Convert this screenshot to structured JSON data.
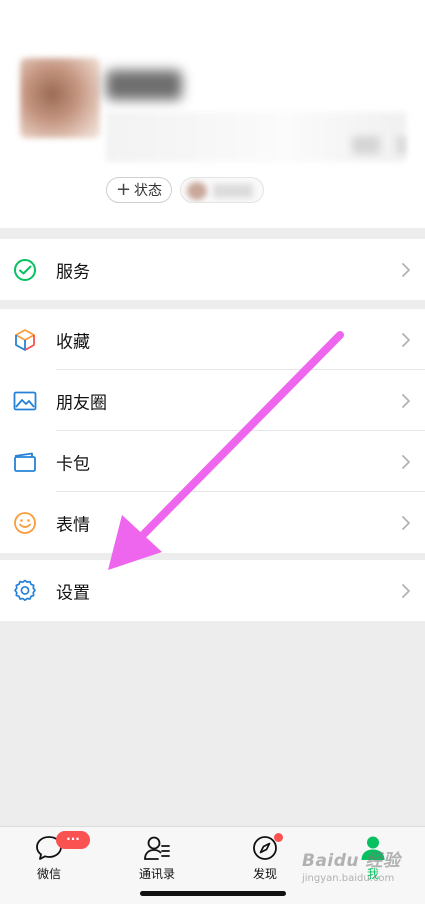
{
  "profile": {
    "status_plus": "+",
    "status_label": "状态"
  },
  "groups": [
    {
      "items": [
        {
          "label": "服务",
          "icon": "wechat-pay-icon"
        }
      ]
    },
    {
      "items": [
        {
          "label": "收藏",
          "icon": "favorites-cube-icon"
        },
        {
          "label": "朋友圈",
          "icon": "moments-image-icon"
        },
        {
          "label": "卡包",
          "icon": "card-wallet-icon"
        },
        {
          "label": "表情",
          "icon": "emoji-smiley-icon"
        }
      ]
    },
    {
      "items": [
        {
          "label": "设置",
          "icon": "gear-icon"
        }
      ]
    }
  ],
  "tabbar": {
    "tabs": [
      {
        "label": "微信",
        "badge": "···",
        "icon": "chat-bubble-icon"
      },
      {
        "label": "通讯录",
        "icon": "contacts-icon"
      },
      {
        "label": "发现",
        "icon": "compass-icon"
      },
      {
        "label": "我",
        "icon": "person-icon",
        "active": true
      }
    ]
  },
  "watermark": {
    "main": "Baidu 经验",
    "sub": "jingyan.baidu.com"
  },
  "colors": {
    "accent_green": "#07c160",
    "badge_red": "#fa5151",
    "annotation_arrow": "#ee66ee"
  }
}
